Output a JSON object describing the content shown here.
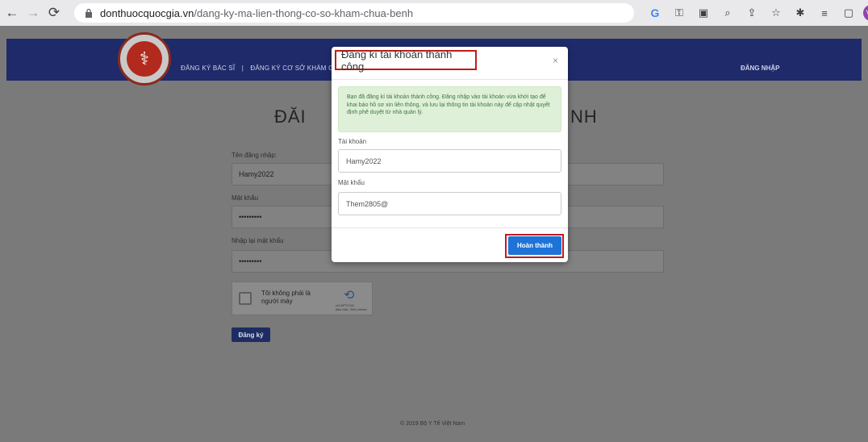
{
  "browser": {
    "url_host": "donthuocquocgia.vn",
    "url_path": "/dang-ky-ma-lien-thong-co-so-kham-chua-benh",
    "profile_initials": "VN"
  },
  "header": {
    "nav_items": [
      "ĐĂNG KÝ BÁC SĨ",
      "|",
      "ĐĂNG KÝ CƠ SỞ KHÁM CHỮ"
    ],
    "login": "ĐĂNG NHẬP"
  },
  "form": {
    "title_left": "ĐĂI",
    "title_right": "NH",
    "username_label": "Tên đăng nhập:",
    "username_value": "Hamy2022",
    "password_label": "Mật khẩu",
    "password_value": "•••••••••",
    "repassword_label": "Nhập lại mật khẩu",
    "repassword_value": "•••••••••",
    "captcha_text": "Tôi không phải là người máy",
    "captcha_brand": "reCAPTCHA",
    "captcha_links": "Bảo mật - Điều khoản",
    "register_button": "Đăng ký"
  },
  "footer": {
    "text": "© 2019 Bộ Y Tế Việt Nam"
  },
  "modal": {
    "title": "Đăng kí tài khoản thành công.",
    "close": "×",
    "message": "Bạn đã đăng kí tài khoản thành công. Đăng nhập vào tài khoản vừa khởi tạo để khai báo hồ sơ xin liên thông, và lưu lại thông tin tài khoản này để cập nhật quyết định phê duyệt từ nhà quản lý.",
    "account_label": "Tài khoản",
    "account_value": "Hamy2022",
    "password_label": "Mật khẩu",
    "password_value": "Them2805@",
    "done_button": "Hoàn thành"
  },
  "colors": {
    "header_bg": "#1f2a6b",
    "primary_button": "#1e73d8",
    "highlight": "#c11b1b",
    "alert_bg": "#dff0d8"
  }
}
